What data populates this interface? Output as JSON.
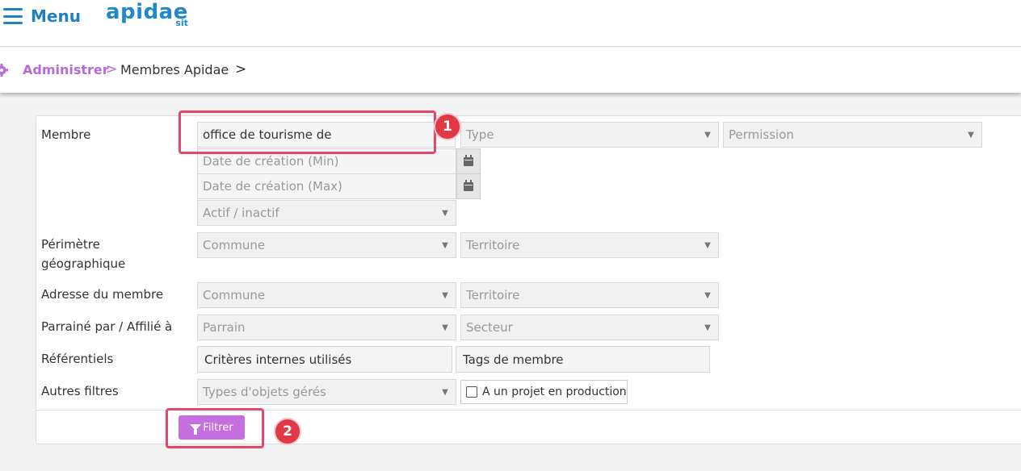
{
  "topbar": {
    "menu_label": "Menu",
    "logo_main": "apidae",
    "logo_sub": "sit"
  },
  "breadcrumb": {
    "admin": "Administrer",
    "separator": ">",
    "members": "Membres Apidae",
    "trailing_separator": ">"
  },
  "form": {
    "membre": {
      "label": "Membre",
      "search_value": "office de tourisme de",
      "type_placeholder": "Type",
      "permission_placeholder": "Permission",
      "date_min_placeholder": "Date de création (Min)",
      "date_max_placeholder": "Date de création (Max)",
      "status_placeholder": "Actif / inactif"
    },
    "perimetre": {
      "label_line1": "Périmètre",
      "label_line2": "géographique",
      "commune_placeholder": "Commune",
      "territoire_placeholder": "Territoire"
    },
    "adresse": {
      "label": "Adresse du membre",
      "commune_placeholder": "Commune",
      "territoire_placeholder": "Territoire"
    },
    "parrainage": {
      "label": "Parrainé par / Affilié à",
      "parrain_placeholder": "Parrain",
      "secteur_placeholder": "Secteur"
    },
    "referentiels": {
      "label": "Référentiels",
      "criteres": "Critères internes utilisés",
      "tags": "Tags de membre"
    },
    "autres": {
      "label": "Autres filtres",
      "types_placeholder": "Types d'objets gérés",
      "checkbox_label": "A un projet en production"
    },
    "filter_button": "Filtrer"
  },
  "annotations": {
    "marker_1": "1",
    "marker_2": "2",
    "highlight_color": "#e8456b",
    "marker_color": "#e03845"
  },
  "colors": {
    "brand_blue": "#1e7fc1",
    "accent_purple": "#c56ee0"
  }
}
